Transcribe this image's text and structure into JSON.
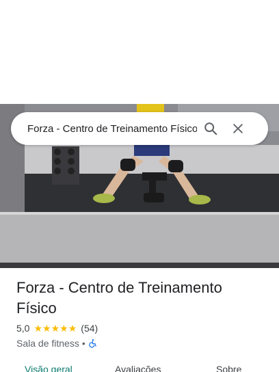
{
  "search": {
    "query": "Forza - Centro de Treinamento Físico"
  },
  "place": {
    "name": "Forza - Centro de Treinamento Físico",
    "rating": "5,0",
    "stars_filled": 5,
    "review_count": "(54)",
    "category": "Sala de fitness",
    "separator": "•"
  },
  "tabs": [
    {
      "label": "Visão geral",
      "active": true
    },
    {
      "label": "Avaliações",
      "active": false
    },
    {
      "label": "Sobre",
      "active": false
    }
  ],
  "colors": {
    "star": "#fbbc04",
    "active_tab": "#0b7b6f",
    "accessibility": "#1a73e8"
  },
  "icons": {
    "search": "search-icon",
    "close": "close-icon",
    "accessibility": "wheelchair-icon"
  }
}
